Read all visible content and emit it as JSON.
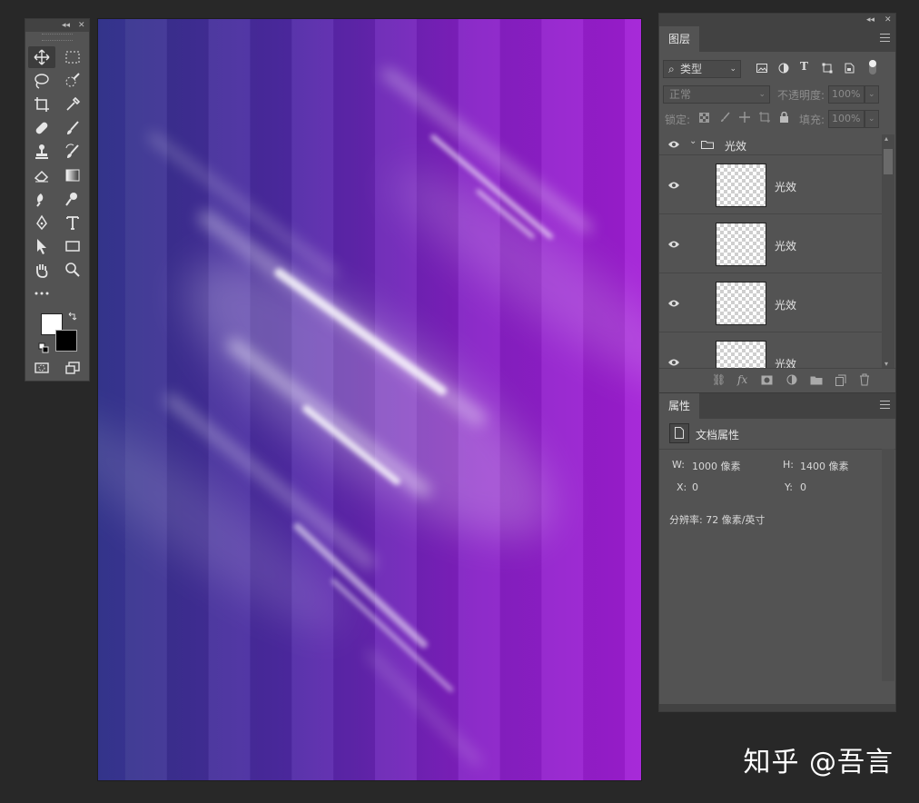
{
  "layers_panel": {
    "tab": "图层",
    "filter_kind": "类型",
    "blend_mode": "正常",
    "opacity_label": "不透明度:",
    "opacity_value": "100%",
    "lock_label": "锁定:",
    "fill_label": "填充:",
    "fill_value": "100%",
    "group_name": "光效",
    "layers": [
      "光效",
      "光效",
      "光效",
      "光效"
    ]
  },
  "properties_panel": {
    "tab": "属性",
    "title": "文档属性",
    "w_label": "W:",
    "w_value": "1000 像素",
    "h_label": "H:",
    "h_value": "1400 像素",
    "x_label": "X:",
    "x_value": "0",
    "y_label": "Y:",
    "y_value": "0",
    "resolution": "分辨率: 72 像素/英寸"
  },
  "watermark": "知乎 @吾言",
  "colors": {
    "foreground": "#ffffff",
    "background": "#000000",
    "canvas_left": "#33348a",
    "canvas_right": "#a21ed6"
  }
}
